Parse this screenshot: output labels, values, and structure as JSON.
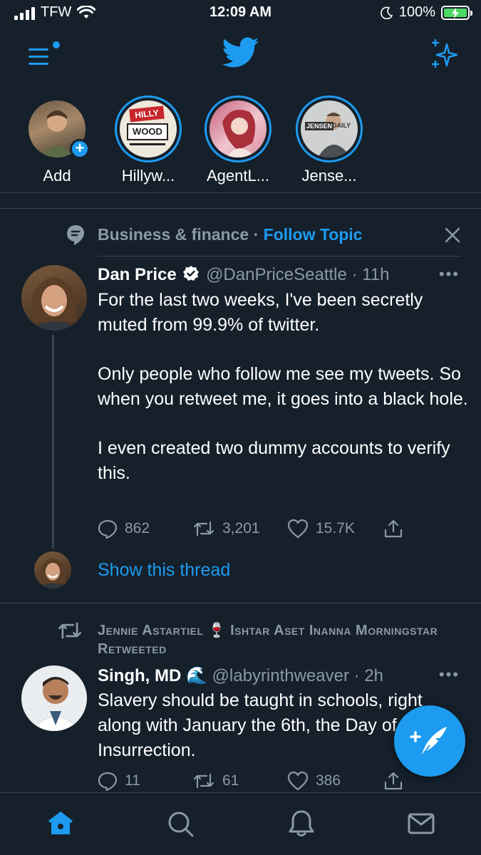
{
  "status_bar": {
    "carrier": "TFW",
    "time": "12:09 AM",
    "battery": "100%"
  },
  "fleets": [
    {
      "name": "Add"
    },
    {
      "name": "Hillyw..."
    },
    {
      "name": "AgentL..."
    },
    {
      "name": "Jense..."
    }
  ],
  "fleet_logos": {
    "hilly_top": "HILLY",
    "hilly_bottom": "WOOD",
    "jensen_left": "JENSEN",
    "jensen_right": "DAILY"
  },
  "topic": {
    "label": "Business & finance",
    "separator": "·",
    "follow": "Follow Topic"
  },
  "tweet1": {
    "name": "Dan Price",
    "handle_time": "@DanPriceSeattle · 11h",
    "paragraphs": [
      "For the last two weeks, I've been secretly muted from 99.9% of twitter.",
      "Only people who follow me see my tweets. So when you retweet me, it goes into a black hole.",
      "I even created two dummy accounts to verify this."
    ],
    "replies": "862",
    "retweets": "3,201",
    "likes": "15.7K",
    "show_thread": "Show this thread"
  },
  "retweeted_by": "Jennie Astartiel 🍷 Ishtar Aset Inanna Morningstar Retweeted",
  "tweet2": {
    "name": "Singh, MD 🌊",
    "handle_time": "@labyrinthweaver · 2h",
    "text": "Slavery should be taught in schools, right along with January the 6th, the Day of Insurrection.",
    "replies": "11",
    "retweets": "61",
    "likes": "386"
  },
  "colors": {
    "background": "#15202b",
    "accent": "#1d9bf0",
    "muted": "#8b98a5",
    "divider": "#38444d"
  },
  "icons": [
    "menu-icon",
    "twitter-bird-icon",
    "sparkle-icon",
    "topic-icon",
    "close-icon",
    "reply-icon",
    "retweet-icon",
    "like-icon",
    "share-icon",
    "more-icon",
    "compose-icon",
    "home-icon",
    "search-icon",
    "notifications-icon",
    "messages-icon"
  ]
}
